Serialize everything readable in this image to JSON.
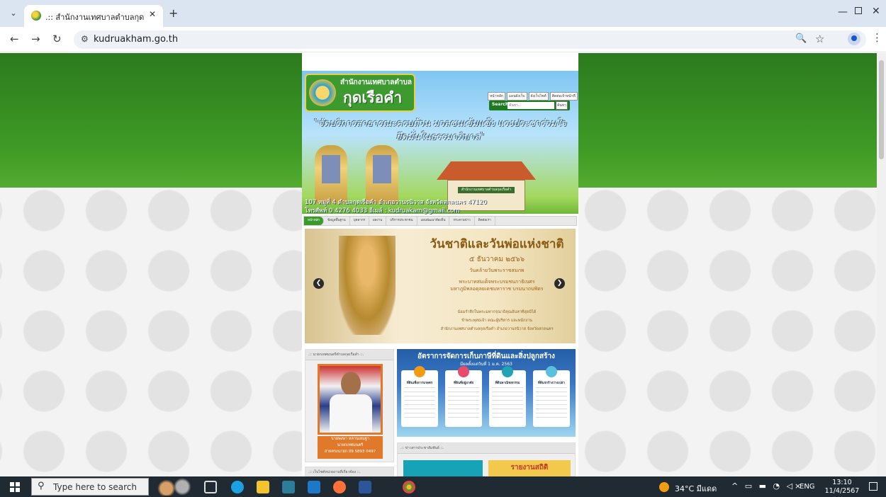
{
  "browser": {
    "tab_title": ".:: สำนักงานเทศบาลตำบลกุดเรือคำ ::.",
    "tab_close": "✕",
    "new_tab": "+",
    "url": "kudruakham.go.th",
    "icons": [
      "tab-search-icon",
      "site-favicon",
      "close-icon",
      "new-tab-icon",
      "minimize-icon",
      "maximize-icon",
      "window-close-icon",
      "back-icon",
      "forward-icon",
      "reload-icon",
      "site-info-icon",
      "zoom-icon",
      "bookmark-star-icon",
      "profile-icon",
      "menu-kebab-icon"
    ]
  },
  "header": {
    "office_name": "สำนักงานเทศบาลตำบล",
    "town_name": "กุดเรือคำ",
    "quicklinks": [
      "หน้าหลัก",
      "แผนผังเว็บ",
      "ผังเว็บไซต์",
      "ติดต่อเจ้าหน้าที่"
    ],
    "search_label": "Search :",
    "search_placeholder": "ค้นหา...",
    "search_button": "ค้นหา",
    "slogan_line1": "\"จัดบริการสาธารณะครบถ้วน มวลชนเข้มแข็ง แรงประชาร่วมใจ",
    "slogan_line2": "ยึดมั่นในธรรมาภิบาล\"",
    "building_sign": "สำนักงานเทศบาลตำบลกุดเรือคำ",
    "address": "107 หมู่ที่ 4 ตำบลกุดเรือคำ อำเภอวานรนิวาส จังหวัดสกลนคร 47120",
    "contact": "โทรศัพท์ 0 4276 4033 อีเมล์ : kudruakam@gmail.com"
  },
  "menu": [
    "หน้าหลัก",
    "ข้อมูลพื้นฐาน",
    "บุคลากร",
    "ผลงาน",
    "บริการประชาชน",
    "แผนพัฒนาท้องถิ่น",
    "กระดานข่าว",
    "ติดต่อเรา"
  ],
  "slider": {
    "title": "วันชาติและวันพ่อแห่งชาติ",
    "date": "๕ ธันวาคม ๒๕๖๖",
    "line1": "วันคล้ายวันพระราชสมภพ",
    "line2": "พระบาทสมเด็จพระบรมชนกาธิเบศร",
    "line3": "มหาภูมิพลอดุลยเดชมหาราช บรมนาถบพิตร",
    "bless1": "น้อมรำลึกในพระมหากรุณาธิคุณอันหาที่สุดมิได้",
    "bless2": "ข้าพระพุทธเจ้า คณะผู้บริหาร และพนักงาน",
    "bless3": "สำนักงานเทศบาลตำบลกุดเรือคำ อำเภอวานรนิวาส จังหวัดสกลนคร",
    "prev": "❮",
    "next": "❯"
  },
  "mayor_panel": {
    "heading": ".:: นายกเทศมนตรีตำบลกุดเรือคำ ::.",
    "name": "นายพงษา หลานเหมฐา",
    "position": "นายกเทศมนตรี",
    "phone": "สายตรงนายก 09 5893 0497"
  },
  "banner": {
    "title": "อัตราการจัดการเก็บภาษีที่ดินและสิ่งปลูกสร้าง",
    "subtitle": "มีผลตั้งแต่วันที่ 1 ม.ค. 2563",
    "cards": [
      "ที่ดินเพื่อการเกษตร",
      "ที่ดินที่อยู่อาศัย",
      "ที่ดินพาณิชยกรรม",
      "ที่ดินรกร้างว่างเปล่า"
    ]
  },
  "news_panel": {
    "heading": ".:: ข่าวสารประชาสัมพันธ์ ::.",
    "report_label": "รายงานสถิติ"
  },
  "left_panel2": {
    "heading": ".:: เว็บไซต์หน่วยงานที่เกี่ยวข้อง ::."
  },
  "taskbar": {
    "search_text": "Type here to search",
    "weather": "34°C มีแดด",
    "lang": "ENG",
    "time": "13:10",
    "date": "11/4/2567"
  }
}
